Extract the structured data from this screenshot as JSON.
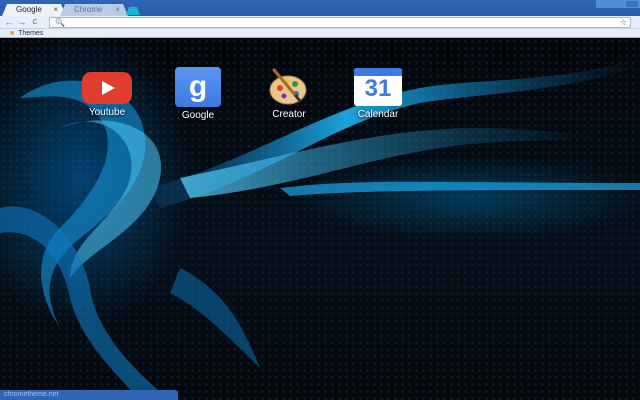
{
  "tabs": [
    {
      "label": "Google",
      "close": "×",
      "active": true
    },
    {
      "label": "Chrome",
      "close": "×",
      "active": false
    }
  ],
  "toolbar": {
    "back": "←",
    "forward": "→",
    "reload": "C",
    "search_glyph": "🔍",
    "address_value": "",
    "star": "☆"
  },
  "bookmarks": {
    "items": [
      {
        "label": "Themes",
        "icon": "folder-icon"
      }
    ]
  },
  "apps": [
    {
      "label": "Youtube",
      "icon": "youtube-icon"
    },
    {
      "label": "Google",
      "icon": "google-icon",
      "glyph": "g"
    },
    {
      "label": "Creator",
      "icon": "palette-icon"
    },
    {
      "label": "Calendar",
      "icon": "calendar-icon",
      "day": "31"
    }
  ],
  "status": {
    "text": "chrometheme.net"
  },
  "colors": {
    "accent": "#2f64b6",
    "glow": "#18a9e8",
    "youtube": "#e13d2f",
    "google": "#3c78de"
  }
}
